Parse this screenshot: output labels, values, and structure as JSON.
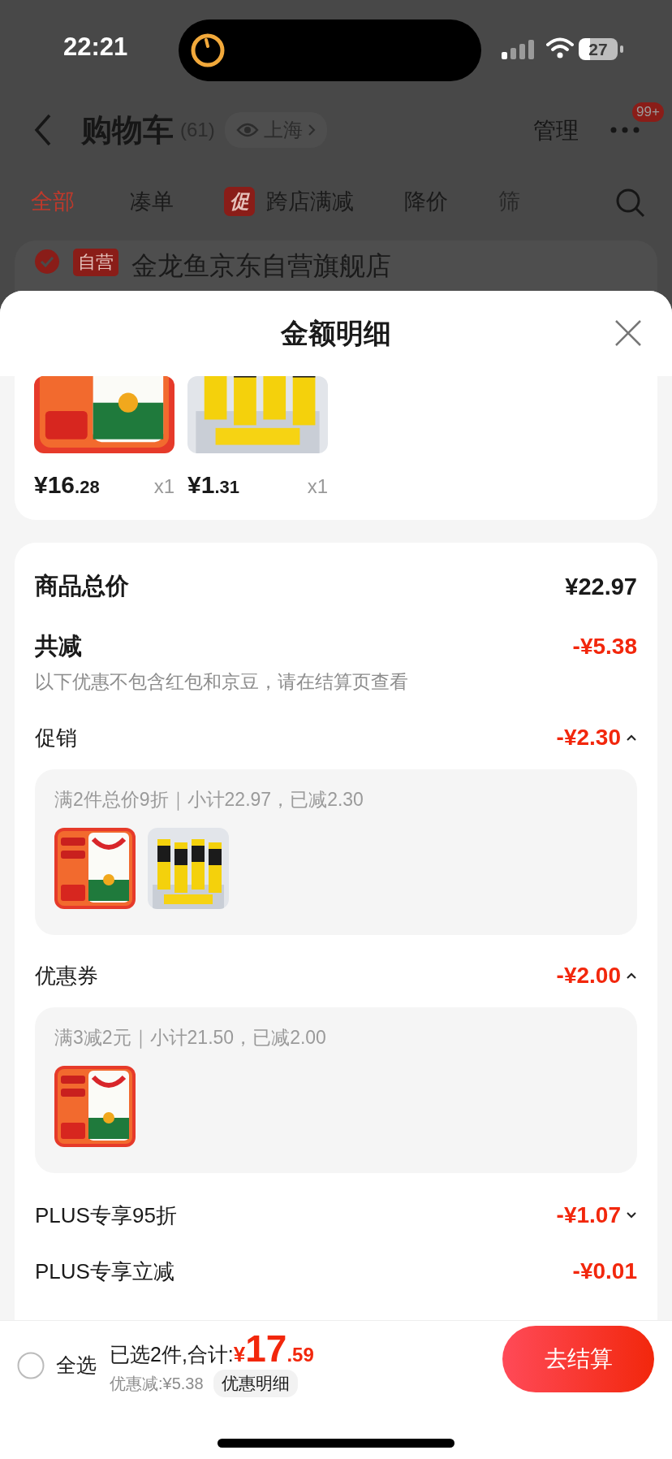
{
  "status_bar": {
    "time": "22:21",
    "battery": "27"
  },
  "header": {
    "title": "购物车",
    "count": "(61)",
    "location": "上海",
    "manage": "管理",
    "more_badge": "99+"
  },
  "tabs": [
    {
      "label": "全部",
      "selected": true
    },
    {
      "label": "凑单",
      "selected": false
    },
    {
      "label": "跨店满减",
      "tag": "促",
      "selected": false
    },
    {
      "label": "降价",
      "selected": false
    },
    {
      "label": "筛",
      "selected": false
    }
  ],
  "store": {
    "tag": "自营",
    "name": "金龙鱼京东自营旗舰店",
    "checked": true
  },
  "sheet": {
    "title": "金额明细",
    "products": [
      {
        "kind": "picture",
        "price_main": "¥16",
        "price_fraction": ".28",
        "quantity": "x1"
      },
      {
        "kind": "picture",
        "price_main": "¥1",
        "price_fraction": ".31",
        "quantity": "x1"
      }
    ],
    "total_label": "商品总价",
    "total": "¥22.97",
    "discount_label": "共减",
    "discount": "-¥5.38",
    "note": "以下优惠不包含红包和京豆，请在结算页查看",
    "sections": [
      {
        "kind": "expandable",
        "label": "促销",
        "amount": "-¥2.30",
        "expanded": true,
        "detail": {
          "text": "满2件总价9折｜小计22.97，已减2.30"
        }
      },
      {
        "kind": "expandable",
        "label": "优惠券",
        "amount": "-¥2.00",
        "expanded": true,
        "detail": {
          "text": "满3减2元｜小计21.50，已减2.00"
        }
      },
      {
        "kind": "expandable",
        "label": "PLUS专享95折",
        "amount": "-¥1.07",
        "expanded": false
      },
      {
        "kind": "plain",
        "label": "PLUS专享立减",
        "amount": "-¥0.01"
      }
    ]
  },
  "bottom_bar": {
    "select_all": {
      "label": "全选",
      "checked": false
    },
    "selected_text": "已选2件,合计:",
    "currency": "¥",
    "total_main": "17",
    "total_fraction": ".59",
    "saving": "优惠减:¥5.38",
    "detail_button": "优惠明细",
    "checkout": "去结算"
  }
}
